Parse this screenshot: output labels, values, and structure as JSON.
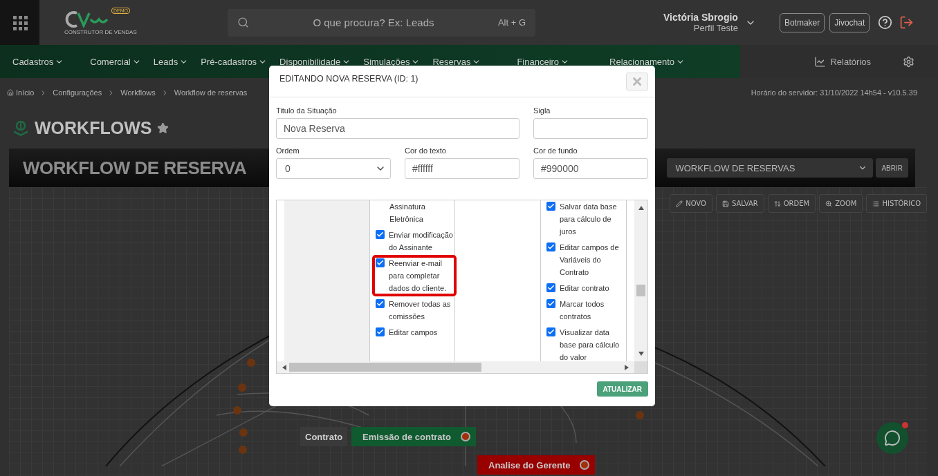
{
  "header": {
    "logo_tagline": "CONSTRUTOR DE VENDAS",
    "logo_badge": "DEMO",
    "search": {
      "placeholder": "O que procura? Ex: Leads",
      "shortcut": "Alt + G"
    },
    "user": {
      "name": "Victória Sbrogio",
      "profile": "Perfil Teste"
    },
    "buttons": [
      "Botmaker",
      "Jivochat"
    ]
  },
  "nav": {
    "items": [
      "Cadastros",
      "Comercial",
      "Leads",
      "Pré-cadastros",
      "Disponibilidade",
      "Simulações",
      "Reservas",
      "Financeiro",
      "Relacionamento"
    ],
    "reports": "Relatórios"
  },
  "breadcrumb": [
    "Início",
    "Configurações",
    "Workflows",
    "Workflow de reservas"
  ],
  "server_time": "Horário do servidor: 31/10/2022 14h54 - v10.5.39",
  "page_title": "WORKFLOWS",
  "favorite": false,
  "banner": {
    "title": "WORKFLOW DE RESERVA",
    "select_value": "WORKFLOW DE RESERVAS",
    "open_button": "ABRIR"
  },
  "toolbar": [
    {
      "kind": "new",
      "label": "NOVO"
    },
    {
      "kind": "save",
      "label": "SALVAR"
    },
    {
      "kind": "order",
      "label": "ORDEM"
    },
    {
      "kind": "zoom",
      "label": "ZOOM"
    },
    {
      "kind": "history",
      "label": "HISTÓRICO"
    }
  ],
  "diagram_nodes": [
    {
      "label": "Contrato",
      "color": "#3a3a3a"
    },
    {
      "label": "Emissão de contrato",
      "color": "#0f5a2f"
    },
    {
      "label": "Analise do Gerente",
      "color": "#990000"
    }
  ],
  "modal": {
    "title": "EDITANDO NOVA RESERVA (ID: 1)",
    "fields": [
      {
        "kind": "text",
        "label": "Titulo da Situação",
        "value": "Nova Reserva"
      },
      {
        "kind": "text",
        "label": "Sigla"
      },
      {
        "kind": "select",
        "label": "Ordem",
        "value": "0"
      },
      {
        "kind": "text",
        "label": "Cor do texto",
        "value": "#ffffff"
      },
      {
        "kind": "text",
        "label": "Cor de fundo",
        "value": "#990000"
      }
    ],
    "permission_columns": [
      {
        "kind": "checklist",
        "lead_text": "Assinatura Eletrônica",
        "items": [
          {
            "label": "Enviar modificação do Assinante",
            "checked": true,
            "highlighted": false
          },
          {
            "label": "Reenviar e-mail para completar dados do cliente.",
            "checked": true,
            "highlighted": true
          },
          {
            "label": "Remover todas as comissões",
            "checked": true,
            "highlighted": false
          },
          {
            "label": "Editar campos",
            "checked": true,
            "highlighted": false
          }
        ]
      },
      {
        "kind": "blank"
      },
      {
        "kind": "checklist",
        "items": [
          {
            "label": "Salvar data base para cálculo de juros",
            "checked": true,
            "highlighted": false
          },
          {
            "label": "Editar campos de Variáveis do Contrato",
            "checked": true,
            "highlighted": false
          },
          {
            "label": "Editar contrato",
            "checked": true,
            "highlighted": false
          },
          {
            "label": "Marcar todos contratos",
            "checked": true,
            "highlighted": false
          },
          {
            "label": "Visualizar data base para cálculo do valor",
            "checked": true,
            "highlighted": false
          }
        ]
      }
    ],
    "submit": "ATUALIZAR"
  }
}
